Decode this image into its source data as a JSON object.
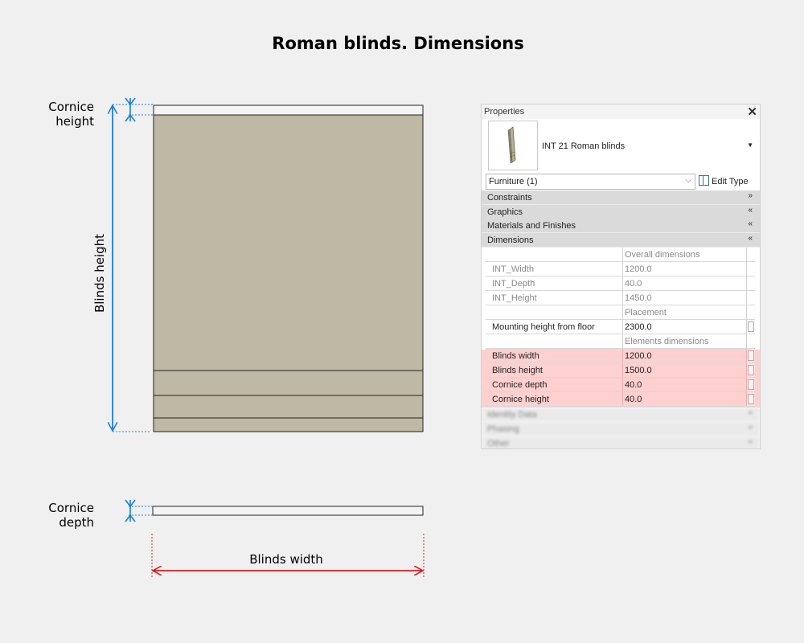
{
  "title": "Roman blinds. Dimensions",
  "labels": {
    "cornice_height": [
      "Cornice",
      "height"
    ],
    "blinds_height": "Blinds height",
    "cornice_depth": [
      "Cornice",
      "depth"
    ],
    "blinds_width": "Blinds width"
  },
  "colors": {
    "blind_fill": "#beb8a4",
    "vertical_dim": "#1e7fd4",
    "horizontal_dim": "#d42020",
    "highlight_row": "#ffd0d0"
  },
  "properties": {
    "header": "Properties",
    "close_icon": "close-icon",
    "type_name": "INT 21 Roman blinds",
    "filter": "Furniture (1)",
    "edit_type": "Edit Type",
    "groups": {
      "constraints": "Constraints",
      "graphics": "Graphics",
      "materials": "Materials and Finishes",
      "dimensions": "Dimensions",
      "identity": "Identity Data",
      "phasing": "Phasing",
      "other": "Other"
    },
    "rows": [
      {
        "name": "",
        "value": "Overall dimensions"
      },
      {
        "name": "INT_Width",
        "value": "1200.0"
      },
      {
        "name": "INT_Depth",
        "value": "40.0"
      },
      {
        "name": "INT_Height",
        "value": "1450.0"
      },
      {
        "name": "",
        "value": "Placement"
      },
      {
        "name": "Mounting height from floor",
        "value": "2300.0"
      },
      {
        "name": "",
        "value": "Elements dimensions"
      },
      {
        "name": "Blinds width",
        "value": "1200.0"
      },
      {
        "name": "Blinds height",
        "value": "1500.0"
      },
      {
        "name": "Cornice depth",
        "value": "40.0"
      },
      {
        "name": "Cornice height",
        "value": "40.0"
      }
    ]
  }
}
